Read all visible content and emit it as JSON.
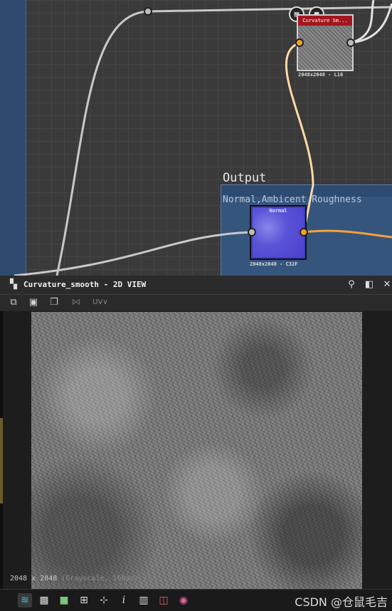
{
  "graph": {
    "frame_title": "Output",
    "frame_description": "Normal,Ambicent,Roughness",
    "node_curvature": {
      "title": "Curvature Sm...",
      "info": "2048x2048 - L16",
      "badge1": "document-icon",
      "badge2": "checker-icon"
    },
    "node_normal": {
      "title": "Normal",
      "info": "2048x2048 - C32F"
    }
  },
  "panel": {
    "title": "Curvature_smooth - 2D VIEW",
    "toolbar": {
      "uv_label": "UV∨"
    },
    "status": {
      "resolution": "2048 x 2048",
      "format": "(Grayscale, 16bpc)"
    },
    "watermark": "CSDN @仓鼠毛吉"
  },
  "colors": {
    "frame_blue": "#35557d",
    "wire_orange": "#f5a03a",
    "wire_light": "#ffd9a8",
    "node_red": "#a3161f"
  }
}
